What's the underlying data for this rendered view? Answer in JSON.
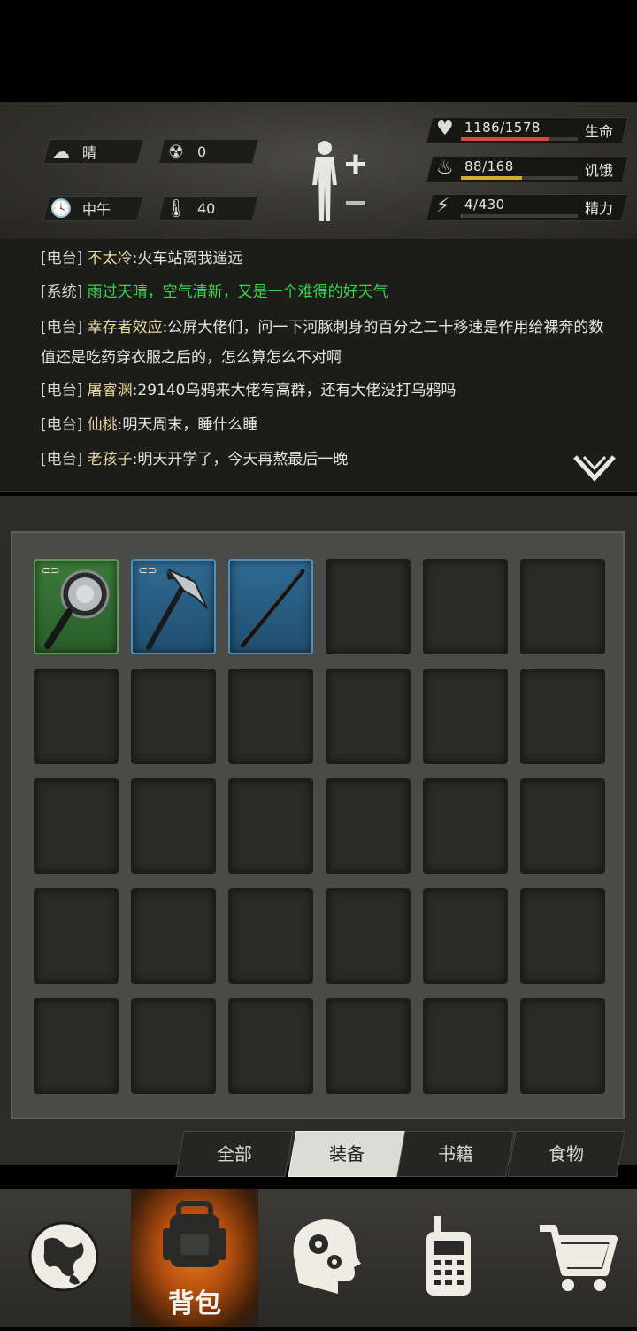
{
  "status": {
    "weather": "晴",
    "radiation": "0",
    "time_of_day": "中午",
    "temperature": "40",
    "health": {
      "value": "1186/1578",
      "label": "生命",
      "fraction": 0.752,
      "color": "#d64b3c"
    },
    "hunger": {
      "value": "88/168",
      "label": "饥饿",
      "fraction": 0.524,
      "color": "#d4a83a"
    },
    "energy": {
      "value": "4/430",
      "label": "精力",
      "fraction": 0.009,
      "color": "#6a6a66"
    }
  },
  "log": {
    "messages": [
      {
        "tag": "[电台]",
        "name": "不太冷",
        "text": ":火车站离我遥远",
        "type": "radio"
      },
      {
        "tag": "[系统]",
        "name": "雨过天晴，空气清新，又是一个难得的好天气",
        "text": "",
        "type": "system"
      },
      {
        "tag": "[电台]",
        "name": "幸存者效应",
        "text": ":公屏大佬们，问一下河豚刺身的百分之二十移速是作用给裸奔的数值还是吃药穿衣服之后的，怎么算怎么不对啊",
        "type": "radio"
      },
      {
        "tag": "[电台]",
        "name": "屠睿渊",
        "text": ":29140乌鸦来大佬有高群，还有大佬没打乌鸦吗",
        "type": "radio"
      },
      {
        "tag": "[电台]",
        "name": "仙桃",
        "text": ":明天周末，睡什么睡",
        "type": "radio"
      },
      {
        "tag": "[电台]",
        "name": "老孩子",
        "text": ":明天开学了，今天再熬最后一晚",
        "type": "radio"
      }
    ]
  },
  "inventory": {
    "items": [
      {
        "icon": "frying-pan-icon",
        "rarity": "green",
        "linked": true
      },
      {
        "icon": "ice-axe-icon",
        "rarity": "blue",
        "linked": true
      },
      {
        "icon": "iron-rod-icon",
        "rarity": "blue",
        "linked": false
      }
    ],
    "total_slots": 30
  },
  "tabs": [
    {
      "label": "全部",
      "active": false
    },
    {
      "label": "装备",
      "active": true
    },
    {
      "label": "书籍",
      "active": false
    },
    {
      "label": "食物",
      "active": false
    }
  ],
  "nav": {
    "items": [
      {
        "icon": "globe-icon",
        "label": "",
        "active": false
      },
      {
        "icon": "backpack-icon",
        "label": "背包",
        "active": true
      },
      {
        "icon": "head-gears-icon",
        "label": "",
        "active": false
      },
      {
        "icon": "radio-icon",
        "label": "",
        "active": false
      },
      {
        "icon": "shopping-cart-icon",
        "label": "",
        "active": false
      }
    ]
  }
}
